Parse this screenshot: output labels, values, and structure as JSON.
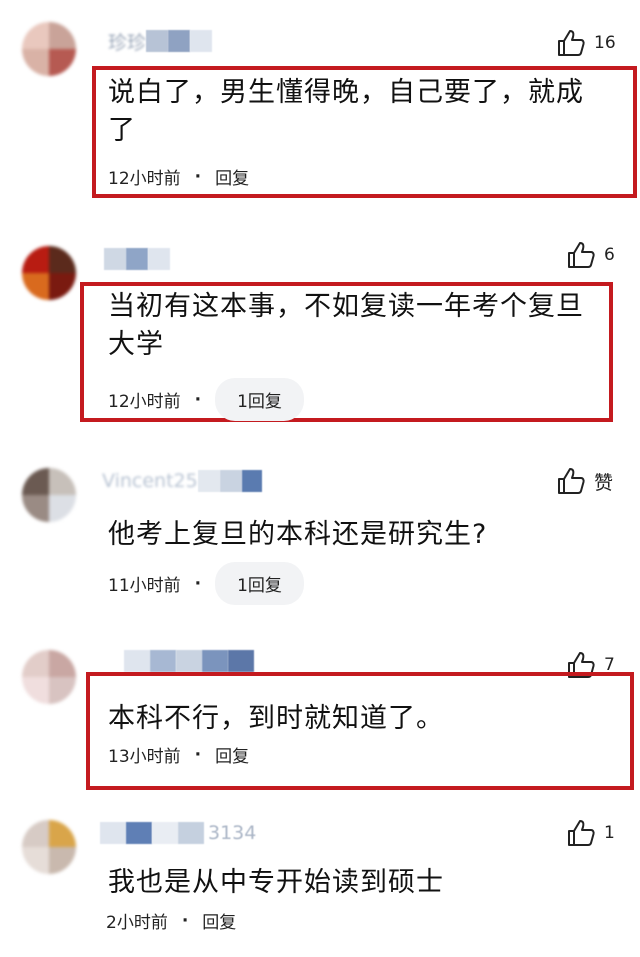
{
  "comments": [
    {
      "username": "珍珍",
      "likes": "16",
      "text_lines": [
        "说白了，男生懂得晚，自己要了，就成",
        "了"
      ],
      "time": "12小时前",
      "reply": "回复",
      "dot": "·"
    },
    {
      "username": "",
      "likes": "6",
      "text_lines": [
        "当初有这本事，不如复读一年考个复旦",
        "大学"
      ],
      "time": "12小时前",
      "reply": "1回复",
      "dot": "·"
    },
    {
      "username": "Vincent25",
      "likes": "赞",
      "text_lines": [
        "他考上复旦的本科还是研究生?"
      ],
      "time": "11小时前",
      "reply": "1回复",
      "dot": "·"
    },
    {
      "username": "",
      "likes": "7",
      "text_lines": [
        "本科不行，到时就知道了。"
      ],
      "time": "13小时前",
      "reply": "回复",
      "dot": "·"
    },
    {
      "username": "3134",
      "likes": "1",
      "text_lines": [
        "我也是从中专开始读到硕士"
      ],
      "time": "2小时前",
      "reply": "回复",
      "dot": "·"
    }
  ],
  "colors": {
    "highlight": "#c41a1f",
    "reply_pill_bg": "#f2f3f5"
  }
}
